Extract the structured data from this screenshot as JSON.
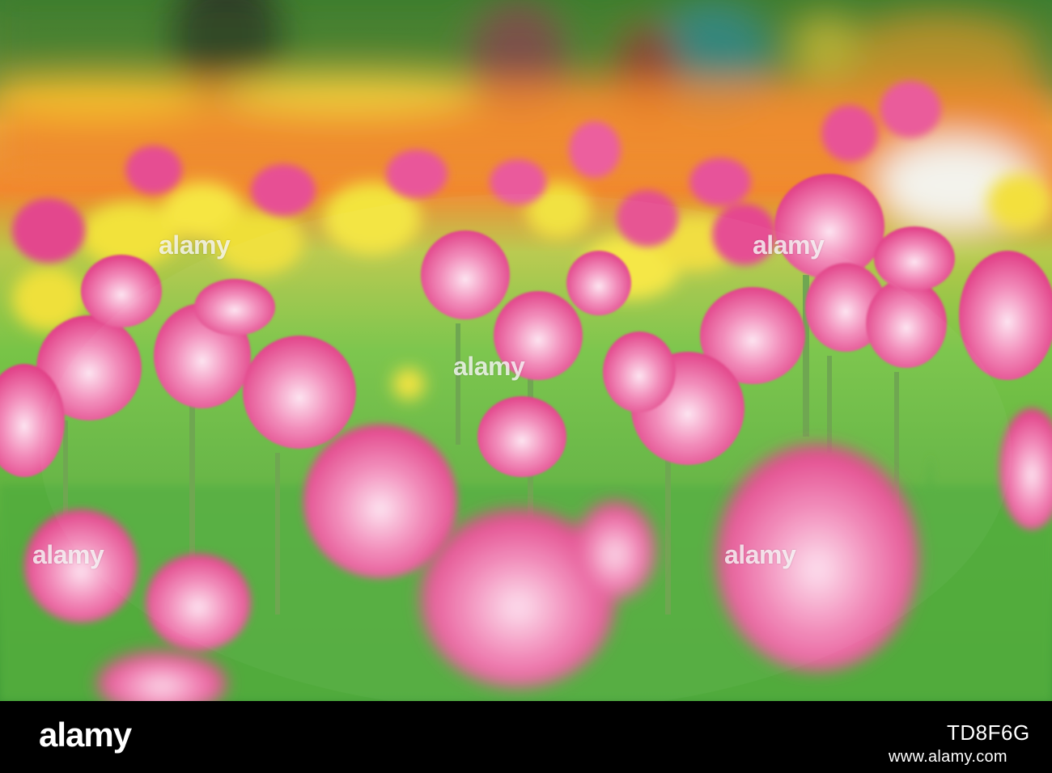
{
  "scene": {
    "description_colors": {
      "tulip_pink": "#e83a83",
      "tulip_light": "#f7b3d2",
      "daffodil_yellow": "#f4e23a",
      "background_orange": "#f2882c",
      "foliage_green": "#5cba44"
    }
  },
  "watermark": {
    "text": "alamy"
  },
  "footer": {
    "logo": "alamy",
    "image_id": "TD8F6G",
    "url": "www.alamy.com"
  }
}
